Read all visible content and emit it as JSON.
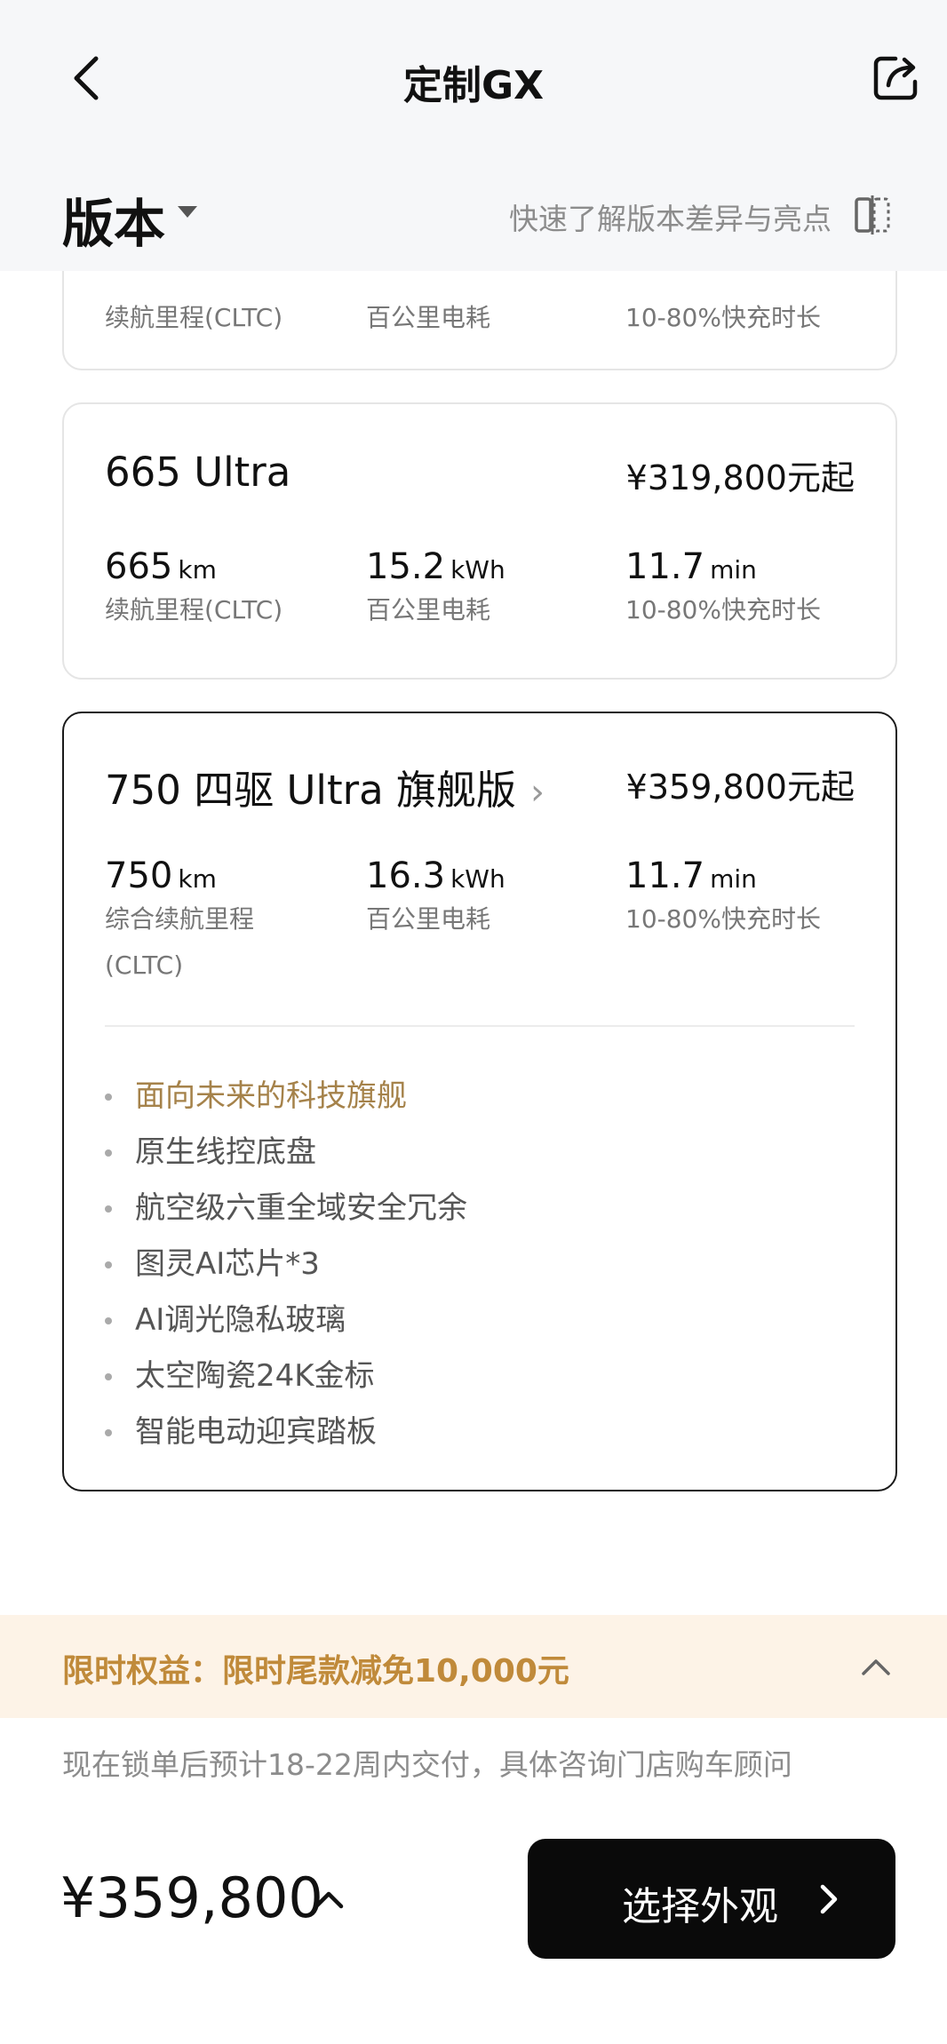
{
  "nav": {
    "title": "定制GX",
    "back_icon": "chevron-left-icon",
    "share_icon": "share-icon"
  },
  "header": {
    "version_label": "版本",
    "compare_link": "快速了解版本差异与亮点",
    "compare_icon": "compare-icon"
  },
  "cards": [
    {
      "specs": [
        {
          "label": "续航里程(CLTC)"
        },
        {
          "label": "百公里电耗"
        },
        {
          "label": "10-80%快充时长"
        }
      ]
    },
    {
      "name": "665 Ultra",
      "price": "¥319,800元起",
      "specs": [
        {
          "value": "665",
          "unit": "km",
          "label": "续航里程(CLTC)"
        },
        {
          "value": "15.2",
          "unit": "kWh",
          "label": "百公里电耗"
        },
        {
          "value": "11.7",
          "unit": "min",
          "label": "10-80%快充时长"
        }
      ]
    },
    {
      "name": "750 四驱 Ultra 旗舰版",
      "chevron": "›",
      "price": "¥359,800元起",
      "selected": true,
      "specs": [
        {
          "value": "750",
          "unit": "km",
          "label": "综合续航里程(CLTC)"
        },
        {
          "value": "16.3",
          "unit": "kWh",
          "label": "百公里电耗"
        },
        {
          "value": "11.7",
          "unit": "min",
          "label": "10-80%快充时长"
        }
      ],
      "features": [
        "面向未来的科技旗舰",
        "原生线控底盘",
        "航空级六重全域安全冗余",
        "图灵AI芯片*3",
        "AI调光隐私玻璃",
        "太空陶瓷24K金标",
        "智能电动迎宾踏板"
      ]
    }
  ],
  "promo": {
    "text": "限时权益：限时尾款减免10,000元",
    "icon": "chevron-up-icon"
  },
  "delivery_note": "现在锁单后预计18-22周内交付，具体咨询门店购车顾问",
  "bottom": {
    "total_price": "¥359,800",
    "caret_icon": "chevron-up-icon",
    "cta_label": "选择外观",
    "cta_icon": "chevron-right-icon"
  },
  "colors": {
    "accent_gold": "#a5824a",
    "promo_text": "#c08a3a",
    "promo_bg": "#fdf3e7",
    "cta_bg": "#0a0a0a"
  }
}
